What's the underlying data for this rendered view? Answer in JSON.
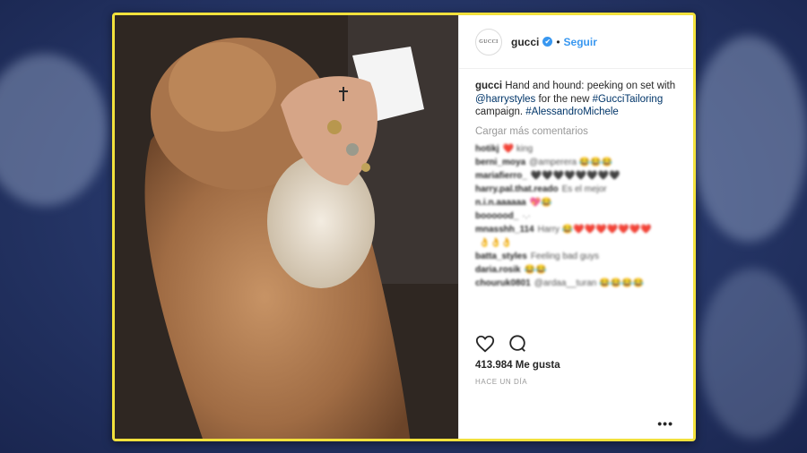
{
  "post": {
    "avatar_text": "GUCCI",
    "username": "gucci",
    "verified_mark": "✔",
    "separator": "•",
    "follow_label": "Seguir",
    "caption": {
      "author": "gucci",
      "text_1": "Hand and hound: peeking on set with",
      "mention": "@harrystyles",
      "text_2": "for the new",
      "hashtag_1": "#GucciTailoring",
      "text_3": "campaign.",
      "hashtag_2": "#AlessandroMichele"
    },
    "load_more_label": "Cargar más comentarios",
    "comments": [
      {
        "user": "hotikj",
        "text": "❤️ king"
      },
      {
        "user": "berni_moya",
        "text": "@amperera 😂😂😂"
      },
      {
        "user": "mariafierro_",
        "text": "🖤🖤🖤🖤🖤🖤🖤🖤"
      },
      {
        "user": "harry.pal.that.reado",
        "text": "Es el mejor"
      },
      {
        "user": "n.i.n.aaaaaa",
        "text": "💖😂"
      },
      {
        "user": "boooood_",
        "text": "·.·"
      },
      {
        "user": "mnasshh_114",
        "text": "Harry 😂❤️❤️❤️❤️❤️❤️❤️"
      },
      {
        "user": "",
        "text": "👌👌👌"
      },
      {
        "user": "batta_styles",
        "text": "Feeling bad guys"
      },
      {
        "user": "daria.rosik",
        "text": "😂😂"
      },
      {
        "user": "chouruk0801",
        "text": "@ardaa__turan 😂😂😂😂"
      }
    ],
    "likes_label": "413.984 Me gusta",
    "time_label": "HACE UN DÍA",
    "more_options": "•••",
    "icons": {
      "like": "heart-icon",
      "comment": "comment-bubble-icon",
      "more": "ellipsis-icon"
    },
    "colors": {
      "frame_border": "#f2e13c",
      "link_blue": "#3897f0",
      "hashtag_blue": "#003569",
      "background_navy": "#27386a"
    }
  }
}
